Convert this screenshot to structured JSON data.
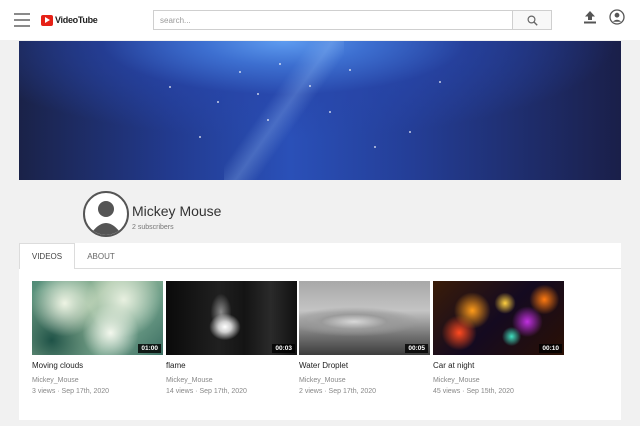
{
  "header": {
    "logo_text": "VideoTube",
    "search_placeholder": "search...",
    "menu_icon": "hamburger-menu-icon",
    "search_icon": "search-icon",
    "upload_icon": "upload-icon",
    "account_icon": "account-icon",
    "logo_color": "#e62117"
  },
  "channel": {
    "name": "Mickey Mouse",
    "subscribers": "2 subscribers"
  },
  "tabs": [
    {
      "label": "VIDEOS",
      "active": true
    },
    {
      "label": "ABOUT",
      "active": false
    }
  ],
  "videos": [
    {
      "title": "Moving clouds",
      "duration": "01:00",
      "channel": "Mickey_Mouse",
      "meta": "3 views · Sep 17th, 2020"
    },
    {
      "title": "flame",
      "duration": "00:03",
      "channel": "Mickey_Mouse",
      "meta": "14 views · Sep 17th, 2020"
    },
    {
      "title": "Water Droplet",
      "duration": "00:05",
      "channel": "Mickey_Mouse",
      "meta": "2 views · Sep 17th, 2020"
    },
    {
      "title": "Car at night",
      "duration": "00:10",
      "channel": "Mickey_Mouse",
      "meta": "45 views · Sep 15th, 2020"
    }
  ]
}
